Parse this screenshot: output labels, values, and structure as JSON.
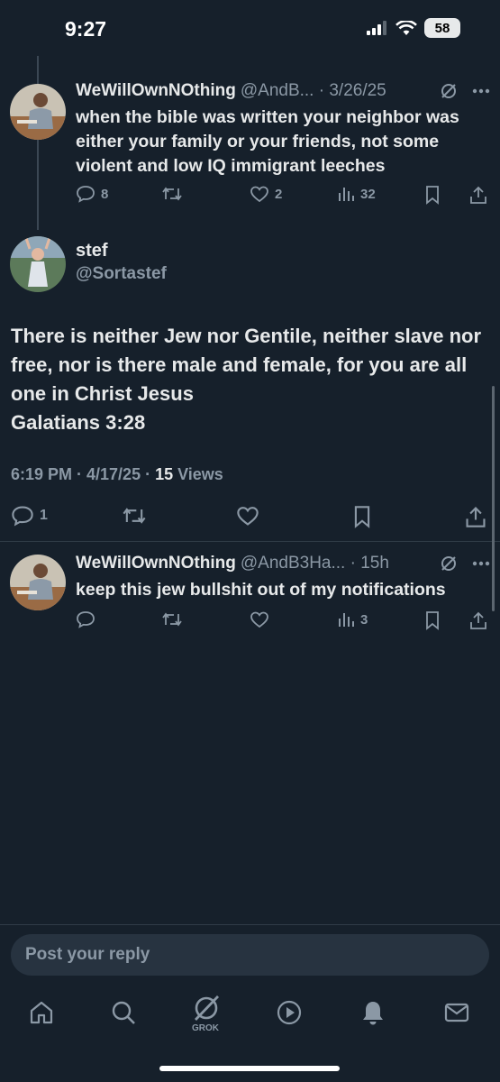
{
  "status_bar": {
    "time": "9:27",
    "battery": "58"
  },
  "reply_one": {
    "name": "WeWillOwnNOthing",
    "handle_meta": "@AndB... · 3/26/25",
    "text": "when the bible was written your neighbor was either your family or your friends, not some violent and low IQ immigrant leeches",
    "replies": "8",
    "likes": "2",
    "views": "32"
  },
  "main_post": {
    "name": "stef",
    "handle": "@Sortastef",
    "text_line1": "There is neither Jew nor Gentile, neither slave nor free, nor is there male and female, for you are all one in Christ Jesus",
    "text_line2": "Galatians 3:28",
    "timestamp": "6:19 PM · 4/17/25 · ",
    "views_count": "15",
    "views_label": " Views",
    "replies": "1"
  },
  "reply_two": {
    "name": "WeWillOwnNOthing",
    "handle_meta": "@AndB3Ha... · 15h",
    "text": "keep this jew bullshit out of my notifications",
    "views": "3"
  },
  "composer": {
    "placeholder": "Post your reply"
  },
  "tabbar": {
    "grok_label": "GROK"
  },
  "colors": {
    "background": "#16202b",
    "muted": "#8b98a5",
    "text": "#e7e9ea"
  }
}
